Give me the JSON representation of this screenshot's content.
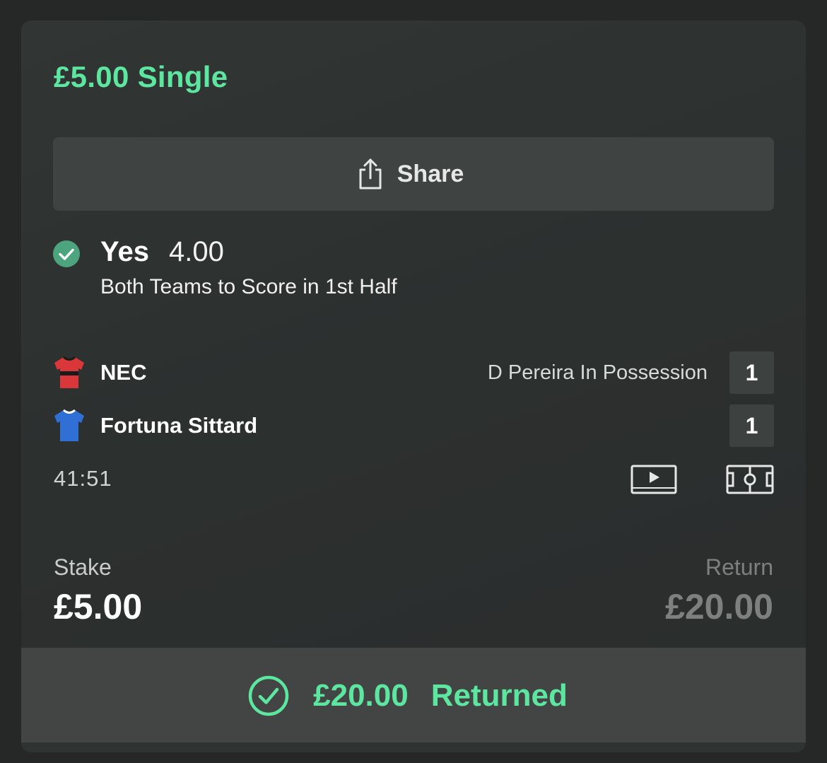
{
  "bet": {
    "title": "£5.00 Single",
    "share_label": "Share",
    "selection": {
      "name": "Yes",
      "odds": "4.00",
      "market": "Both Teams to Score in 1st Half",
      "status_icon": "check-circle-icon"
    }
  },
  "match": {
    "home": {
      "name": "NEC",
      "score": "1",
      "possession": "D Pereira In Possession",
      "shirt_colors": [
        "#d9373a",
        "#1a1a1a"
      ]
    },
    "away": {
      "name": "Fortuna Sittard",
      "score": "1",
      "possession": "",
      "shirt_colors": [
        "#2f6fd6",
        "#ffffff"
      ]
    },
    "clock": "41:51",
    "icons": [
      "video-play-icon",
      "pitch-icon"
    ]
  },
  "stake": {
    "label": "Stake",
    "value": "£5.00"
  },
  "return": {
    "label": "Return",
    "value": "£20.00"
  },
  "result": {
    "amount": "£20.00",
    "label": "Returned",
    "icon": "check-circle-outline-icon"
  },
  "colors": {
    "accent": "#5ce6a0",
    "background": "#262828",
    "card": "#2e3231"
  }
}
